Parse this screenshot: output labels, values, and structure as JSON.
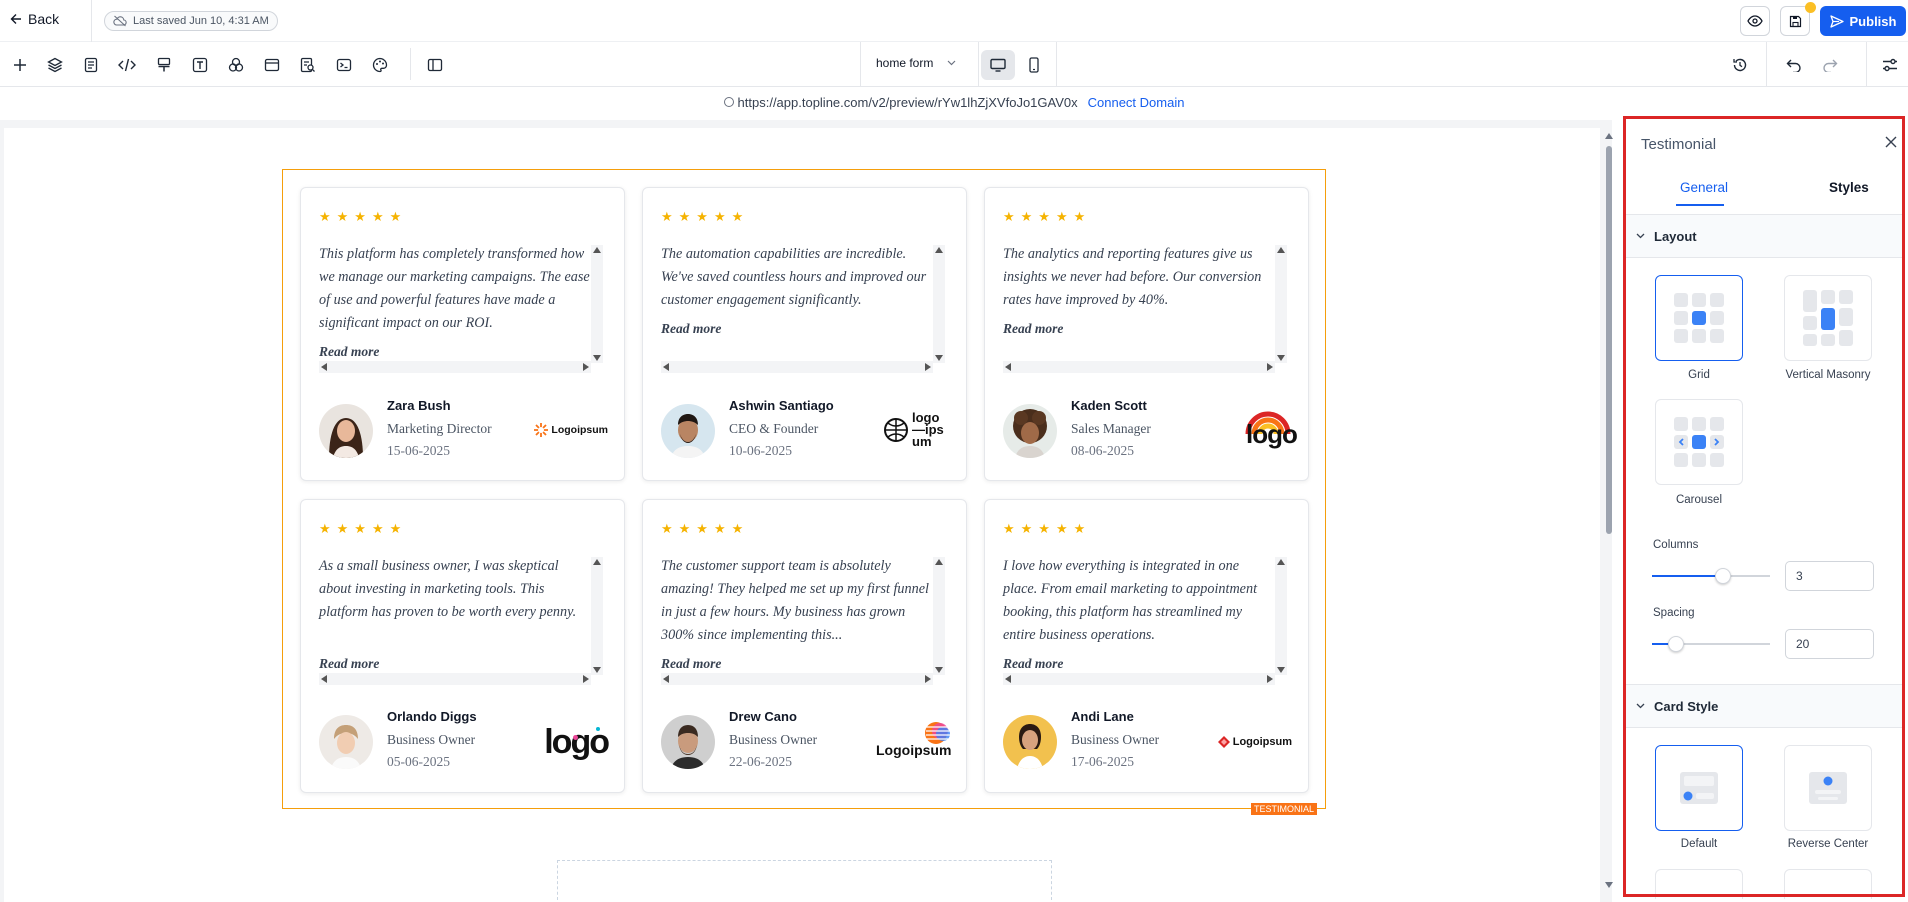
{
  "header": {
    "back_label": "Back",
    "last_saved": "Last saved Jun 10, 4:31 AM",
    "publish_label": "Publish",
    "accent_color": "#155eef"
  },
  "toolbar": {
    "page_selector": "home form",
    "tools": [
      "add-icon",
      "layers-icon",
      "pages-icon",
      "code-icon",
      "paint-icon",
      "text-icon",
      "components-icon",
      "sections-icon",
      "search-page-icon",
      "terminal-icon",
      "theme-icon",
      "split-view-icon"
    ]
  },
  "preview": {
    "url": "https://app.topline.com/v2/preview/rYw1lhZjXVfoJo1GAV0x",
    "connect_domain": "Connect Domain"
  },
  "section": {
    "tag": "TESTIMONIAL"
  },
  "testimonials": [
    {
      "stars": "★★★★★",
      "quote": "This platform has completely transformed how we manage our marketing campaigns. The ease of use and powerful features have made a significant impact on our ROI.",
      "read_more": "Read more",
      "name": "Zara Bush",
      "role": "Marketing Director",
      "date": "15-06-2025",
      "logo_text": "Logoipsum"
    },
    {
      "stars": "★★★★★",
      "quote": "The automation capabilities are incredible. We've saved countless hours and improved our customer engagement significantly.",
      "read_more": "Read more",
      "name": "Ashwin Santiago",
      "role": "CEO & Founder",
      "date": "10-06-2025",
      "logo_text": "logo—ipsum"
    },
    {
      "stars": "★★★★★",
      "quote": "The analytics and reporting features give us insights we never had before. Our conversion rates have improved by 40%.",
      "read_more": "Read more",
      "name": "Kaden Scott",
      "role": "Sales Manager",
      "date": "08-06-2025",
      "logo_text": "logo"
    },
    {
      "stars": "★★★★★",
      "quote": "As a small business owner, I was skeptical about investing in marketing tools. This platform has proven to be worth every penny.",
      "read_more": "Read more",
      "name": "Orlando Diggs",
      "role": "Business Owner",
      "date": "05-06-2025",
      "logo_text": "logo"
    },
    {
      "stars": "★★★★★",
      "quote": "The customer support team is absolutely amazing! They helped me set up my first funnel in just a few hours. My business has grown 300% since implementing this...",
      "read_more": "Read more",
      "name": "Drew Cano",
      "role": "Business Owner",
      "date": "22-06-2025",
      "logo_text": "Logoipsum"
    },
    {
      "stars": "★★★★★",
      "quote": "I love how everything is integrated in one place. From email marketing to appointment booking, this platform has streamlined my entire business operations.",
      "read_more": "Read more",
      "name": "Andi Lane",
      "role": "Business Owner",
      "date": "17-06-2025",
      "logo_text": "Logoipsum"
    }
  ],
  "panel": {
    "title": "Testimonial",
    "tabs": {
      "general": "General",
      "styles": "Styles"
    },
    "layout": {
      "heading": "Layout",
      "options": [
        "Grid",
        "Vertical Masonry",
        "Carousel"
      ],
      "selected": "Grid"
    },
    "columns": {
      "label": "Columns",
      "value": "3",
      "slider_fraction": 0.6
    },
    "spacing": {
      "label": "Spacing",
      "value": "20",
      "slider_fraction": 0.2
    },
    "card_style": {
      "heading": "Card Style",
      "options": [
        "Default",
        "Reverse Center"
      ],
      "selected": "Default"
    }
  }
}
